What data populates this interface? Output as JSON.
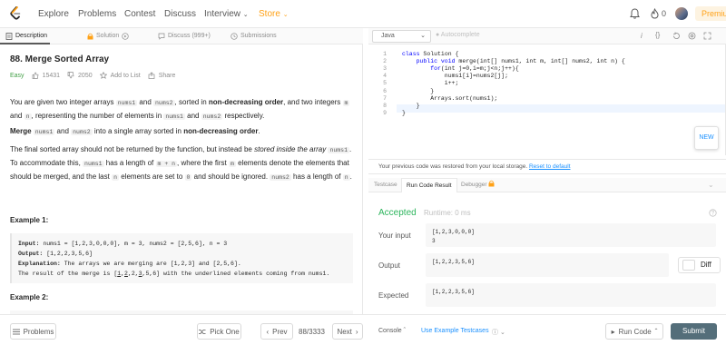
{
  "nav": {
    "items": [
      "Explore",
      "Problems",
      "Contest",
      "Discuss",
      "Interview",
      "Store"
    ],
    "fire_count": "0",
    "premium": "Premium"
  },
  "tabs": {
    "description": "Description",
    "solution": "Solution",
    "discuss": "Discuss (999+)",
    "submissions": "Submissions"
  },
  "problem": {
    "title": "88. Merge Sorted Array",
    "difficulty": "Easy",
    "likes": "15431",
    "dislikes": "2050",
    "add_to_list": "Add to List",
    "share": "Share"
  },
  "description": {
    "p1": {
      "a": "You are given two integer arrays",
      "c1": "nums1",
      "b": "and",
      "c2": "nums2",
      "c": ", sorted in",
      "bold": "non-decreasing order",
      "d": ", and two integers",
      "c3": "m",
      "e": "and",
      "c4": "n",
      "f": ", representing the number of elements in",
      "c5": "nums1",
      "g": "and",
      "c6": "nums2",
      "h": "respectively."
    },
    "p2": {
      "bold1": "Merge",
      "c1": "nums1",
      "a": "and",
      "c2": "nums2",
      "b": "into a single array sorted in",
      "bold2": "non-decreasing order",
      "c": "."
    },
    "p3": {
      "a": "The final sorted array should not be returned by the function, but instead be",
      "italic": "stored inside the array",
      "c1": "nums1",
      "b": ". To accommodate this,",
      "c2": "nums1",
      "c": "has a length of",
      "c3": "m + n",
      "d": ", where the first",
      "c4": "m",
      "e": "elements denote the elements that should be merged, and the last",
      "c5": "n",
      "f": "elements are set to",
      "c6": "0",
      "g": "and should be ignored.",
      "c7": "nums2",
      "h": "has a length of",
      "c8": "n",
      "i": "."
    },
    "example1_title": "Example 1:",
    "example1": {
      "input_label": "Input:",
      "input": "nums1 = [1,2,3,0,0,0], m = 3, nums2 = [2,5,6], n = 3",
      "output_label": "Output:",
      "output": "[1,2,2,3,5,6]",
      "explanation_label": "Explanation:",
      "explanation1": "The arrays we are merging are [1,2,3] and [2,5,6].",
      "explanation2_a": "The result of the merge is [",
      "explanation2_u1": "1",
      "explanation2_b": ",",
      "explanation2_u2": "2",
      "explanation2_c": ",2,",
      "explanation2_u3": "3",
      "explanation2_d": ",5,6] with the underlined elements coming from nums1."
    },
    "example2_title": "Example 2:"
  },
  "left_bar": {
    "problems": "Problems",
    "pick_one": "Pick One",
    "prev": "Prev",
    "page": "88/3333",
    "next": "Next"
  },
  "editor": {
    "language": "Java",
    "autocomplete": "Autocomplete",
    "line_numbers": [
      "1",
      "2",
      "3",
      "4",
      "5",
      "6",
      "7",
      "8",
      "9"
    ],
    "lines": [
      {
        "kw": "class",
        "rest": " Solution {"
      },
      {
        "kw": "    public void",
        "rest": " merge(int[] nums1, int m, int[] nums2, int n) {"
      },
      {
        "kw": "        for",
        "rest": "(int j=0,i=m;j<n;j++){"
      },
      {
        "kw": "",
        "rest": "            nums1[i]=nums2[j];"
      },
      {
        "kw": "",
        "rest": "            i++;"
      },
      {
        "kw": "",
        "rest": "        }"
      },
      {
        "kw": "",
        "rest": "        Arrays.sort(nums1);"
      },
      {
        "kw": "",
        "rest": "    }"
      },
      {
        "kw": "",
        "rest": "}"
      }
    ],
    "new_badge": "NEW"
  },
  "restore": {
    "message": "Your previous code was restored from your local storage.",
    "reset": "Reset to default"
  },
  "result_tabs": {
    "testcase": "Testcase",
    "run_result": "Run Code Result",
    "debugger": "Debugger"
  },
  "result": {
    "status": "Accepted",
    "runtime": "Runtime: 0 ms",
    "input_label": "Your input",
    "input_line1": "[1,2,3,0,0,0]",
    "input_line2": "3",
    "output_label": "Output",
    "output": "[1,2,2,3,5,6]",
    "diff": "Diff",
    "expected_label": "Expected",
    "expected": "[1,2,2,3,5,6]"
  },
  "right_bar": {
    "console": "Console",
    "use_example": "Use Example Testcases",
    "run_code": "Run Code",
    "submit": "Submit"
  },
  "colors": {
    "accent": "#ffa116",
    "accepted": "#2db55d",
    "easy": "#43a047",
    "link": "#1a90ff",
    "submit": "#546e7a"
  }
}
